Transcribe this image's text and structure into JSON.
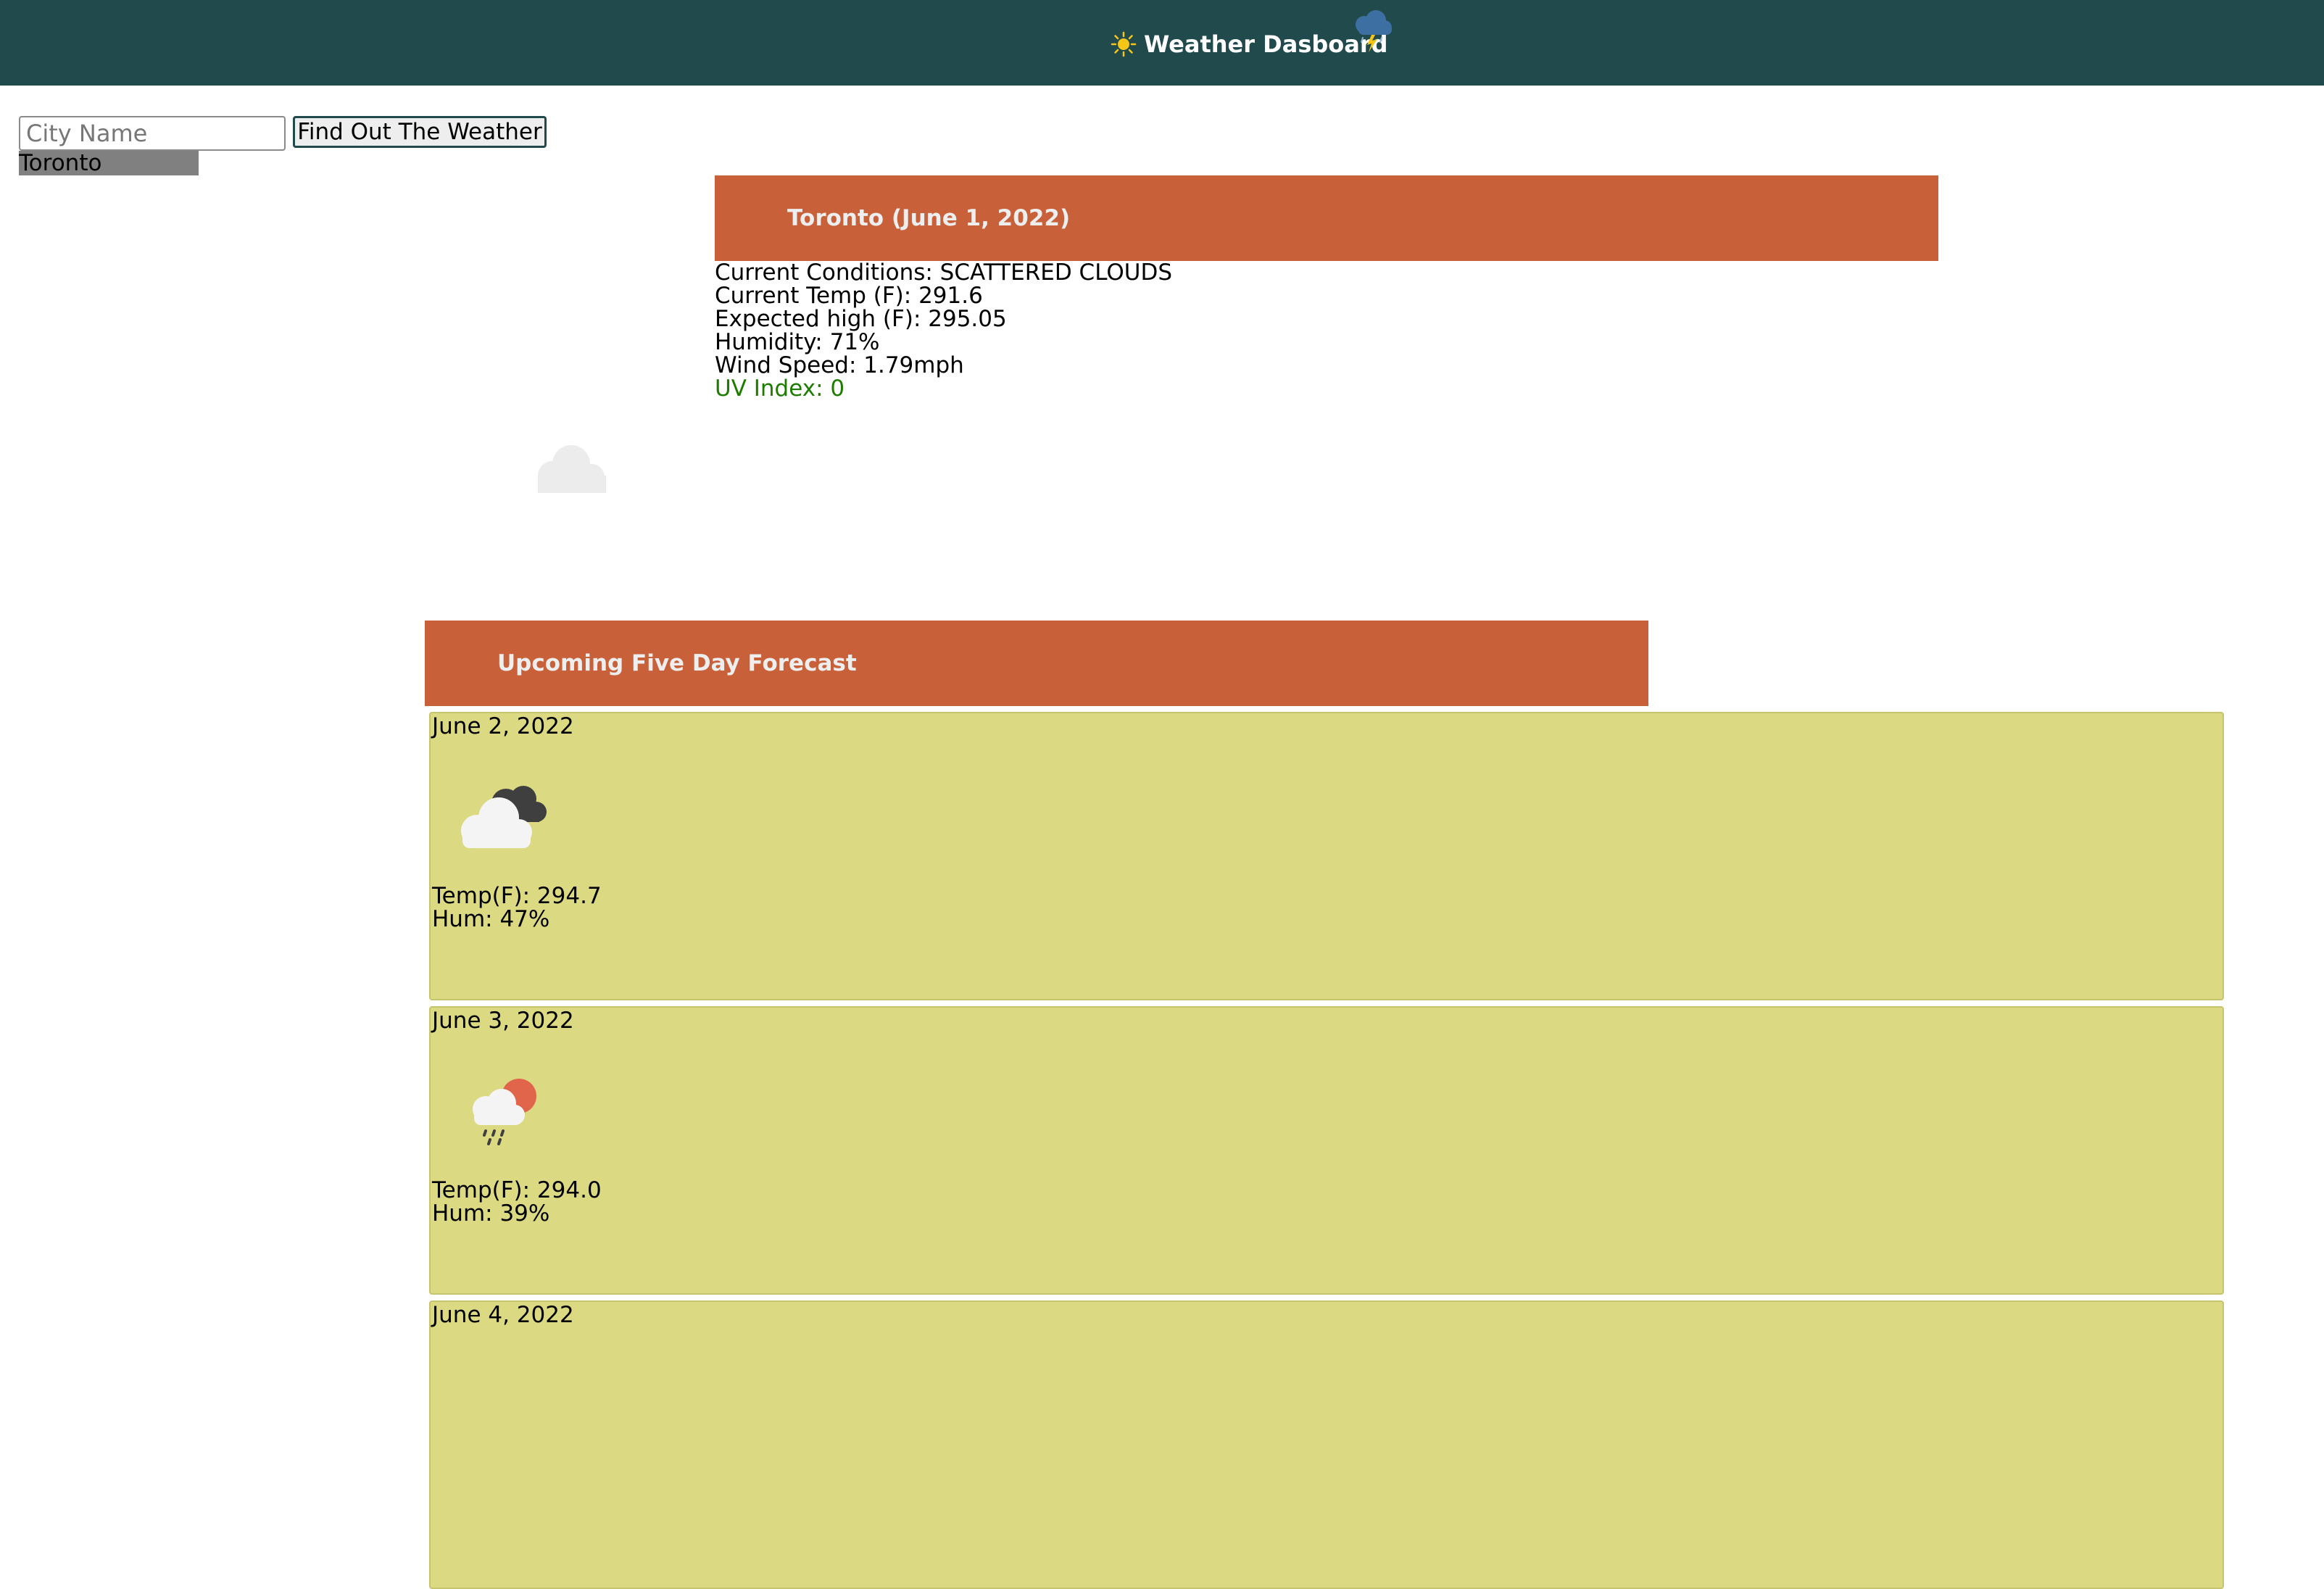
{
  "header": {
    "title": "Weather Dasboard",
    "left_icon": "sun-icon",
    "right_icon": "thunderstorm-cloud-icon"
  },
  "search": {
    "placeholder": "City Name",
    "value": "",
    "button_label": "Find Out The Weather"
  },
  "history": [
    "Toronto"
  ],
  "current": {
    "banner_title": "Toronto (June 1, 2022)",
    "conditions_label": "Current Conditions: SCATTERED CLOUDS",
    "temp_label": "Current Temp (F): 291.6",
    "high_label": "Expected high (F): 295.05",
    "humidity_label": "Humidity: 71%",
    "wind_label": "Wind Speed: 1.79mph",
    "uv_label": "UV Index: 0",
    "icon": "scattered-clouds-icon"
  },
  "forecast": {
    "banner_title": "Upcoming Five Day Forecast",
    "days": [
      {
        "date": "June 2, 2022",
        "temp": "Temp(F): 294.7",
        "hum": "Hum: 47%",
        "icon": "broken-clouds-icon"
      },
      {
        "date": "June 3, 2022",
        "temp": "Temp(F): 294.0",
        "hum": "Hum: 39%",
        "icon": "rain-sun-icon"
      },
      {
        "date": "June 4, 2022",
        "temp": "",
        "hum": "",
        "icon": ""
      }
    ]
  },
  "colors": {
    "header_bg": "#214a4c",
    "banner_bg": "#c8603a",
    "card_bg": "#dcd983",
    "uv_text": "#1e7d00",
    "history_bg": "#808080"
  }
}
